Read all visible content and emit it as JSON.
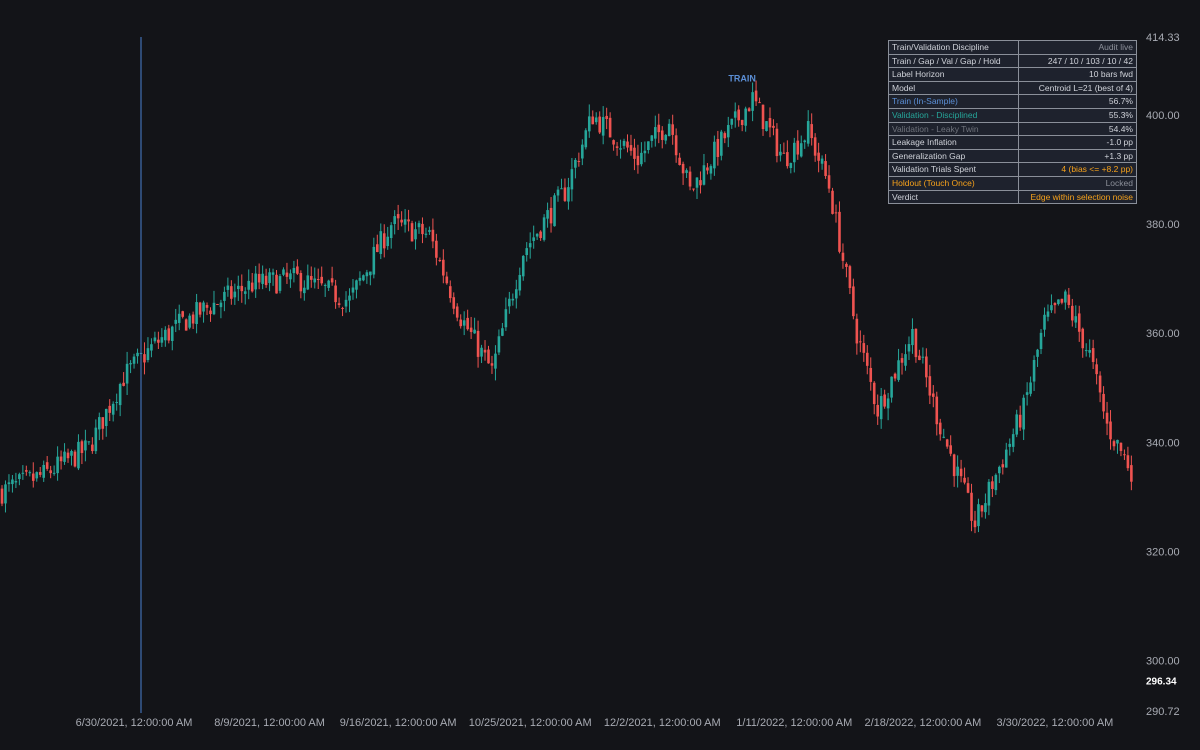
{
  "chart_data": {
    "type": "candlestick",
    "y_axis": {
      "range": [
        290.72,
        414.33
      ],
      "ticks": [
        "300.00",
        "320.00",
        "340.00",
        "360.00",
        "380.00",
        "400.00"
      ],
      "max_label": "414.33",
      "min_label": "290.72",
      "last_price_label": "296.34"
    },
    "x_axis": {
      "ticks": [
        "6/30/2021, 12:00:00 AM",
        "8/9/2021, 12:00:00 AM",
        "9/16/2021, 12:00:00 AM",
        "10/25/2021, 12:00:00 AM",
        "12/2/2021, 12:00:00 AM",
        "1/11/2022, 12:00:00 AM",
        "2/18/2022, 12:00:00 AM",
        "3/30/2022, 12:00:00 AM"
      ],
      "tick_bar_index": [
        38,
        77,
        114,
        152,
        190,
        228,
        265,
        303
      ]
    },
    "split_marker": {
      "bar_index": 40,
      "color": "#4a7fd0"
    },
    "annotation": {
      "text": "TRAIN",
      "bar_index": 213,
      "price": 404.5
    },
    "colors": {
      "up": "#26a69a",
      "down": "#ef5350",
      "grid_text": "#a8abb3",
      "background": "#131418"
    },
    "bars": 326,
    "close_path": [
      [
        0,
        331
      ],
      [
        12,
        334
      ],
      [
        25,
        339
      ],
      [
        35,
        352
      ],
      [
        44,
        358
      ],
      [
        52,
        362
      ],
      [
        60,
        365
      ],
      [
        72,
        369
      ],
      [
        85,
        370
      ],
      [
        100,
        366
      ],
      [
        112,
        380
      ],
      [
        123,
        378
      ],
      [
        132,
        363
      ],
      [
        141,
        353
      ],
      [
        150,
        375
      ],
      [
        162,
        386
      ],
      [
        170,
        400
      ],
      [
        183,
        392
      ],
      [
        192,
        399
      ],
      [
        198,
        386
      ],
      [
        208,
        396
      ],
      [
        216,
        403
      ],
      [
        225,
        392
      ],
      [
        232,
        397
      ],
      [
        238,
        387
      ],
      [
        246,
        360
      ],
      [
        252,
        346
      ],
      [
        262,
        360
      ],
      [
        270,
        343
      ],
      [
        280,
        325
      ],
      [
        294,
        346
      ],
      [
        300,
        362
      ],
      [
        306,
        366
      ],
      [
        313,
        356
      ],
      [
        318,
        343
      ],
      [
        325,
        335
      ]
    ]
  },
  "audit_table": {
    "rows": [
      {
        "label": "Train/Validation Discipline",
        "value": "Audit live",
        "label_color": "#d0d3da",
        "value_color": "#8c909a"
      },
      {
        "label": "Train / Gap / Val / Gap / Hold",
        "value": "247 / 10 / 103 / 10 / 42",
        "label_color": "#d0d3da",
        "value_color": "#d0d3da"
      },
      {
        "label": "Label Horizon",
        "value": "10 bars fwd",
        "label_color": "#d0d3da",
        "value_color": "#d0d3da"
      },
      {
        "label": "Model",
        "value": "Centroid L=21 (best of 4)",
        "label_color": "#d0d3da",
        "value_color": "#d0d3da"
      },
      {
        "label": "Train (In-Sample)",
        "value": "56.7%",
        "label_color": "#5b8fd6",
        "value_color": "#d0d3da"
      },
      {
        "label": "Validation - Disciplined",
        "value": "55.3%",
        "label_color": "#26a69a",
        "value_color": "#d0d3da"
      },
      {
        "label": "Validation - Leaky Twin",
        "value": "54.4%",
        "label_color": "#6f737c",
        "value_color": "#d0d3da"
      },
      {
        "label": "Leakage Inflation",
        "value": "-1.0 pp",
        "label_color": "#d0d3da",
        "value_color": "#d0d3da"
      },
      {
        "label": "Generalization Gap",
        "value": "+1.3 pp",
        "label_color": "#d0d3da",
        "value_color": "#d0d3da"
      },
      {
        "label": "Validation Trials Spent",
        "value": "4  (bias <= +8.2 pp)",
        "label_color": "#d0d3da",
        "value_color": "#f7a21b"
      },
      {
        "label": "Holdout (Touch Once)",
        "value": "Locked",
        "label_color": "#f7a21b",
        "value_color": "#8c909a"
      },
      {
        "label": "Verdict",
        "value": "Edge within selection noise",
        "label_color": "#d0d3da",
        "value_color": "#f7a21b"
      }
    ]
  }
}
